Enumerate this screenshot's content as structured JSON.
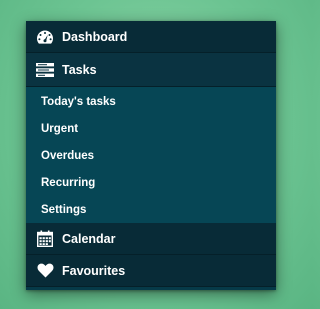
{
  "menu": {
    "items": [
      {
        "label": "Dashboard",
        "icon": "dashboard-icon"
      },
      {
        "label": "Tasks",
        "icon": "tasks-icon"
      },
      {
        "label": "Calendar",
        "icon": "calendar-icon"
      },
      {
        "label": "Favourites",
        "icon": "heart-icon"
      }
    ],
    "tasks_submenu": [
      {
        "label": "Today's tasks"
      },
      {
        "label": "Urgent"
      },
      {
        "label": "Overdues"
      },
      {
        "label": "Recurring"
      },
      {
        "label": "Settings"
      }
    ]
  },
  "colors": {
    "page_background": "#6cc492",
    "menu_header": "#082b37",
    "submenu_background": "#064655",
    "text": "#ffffff"
  }
}
